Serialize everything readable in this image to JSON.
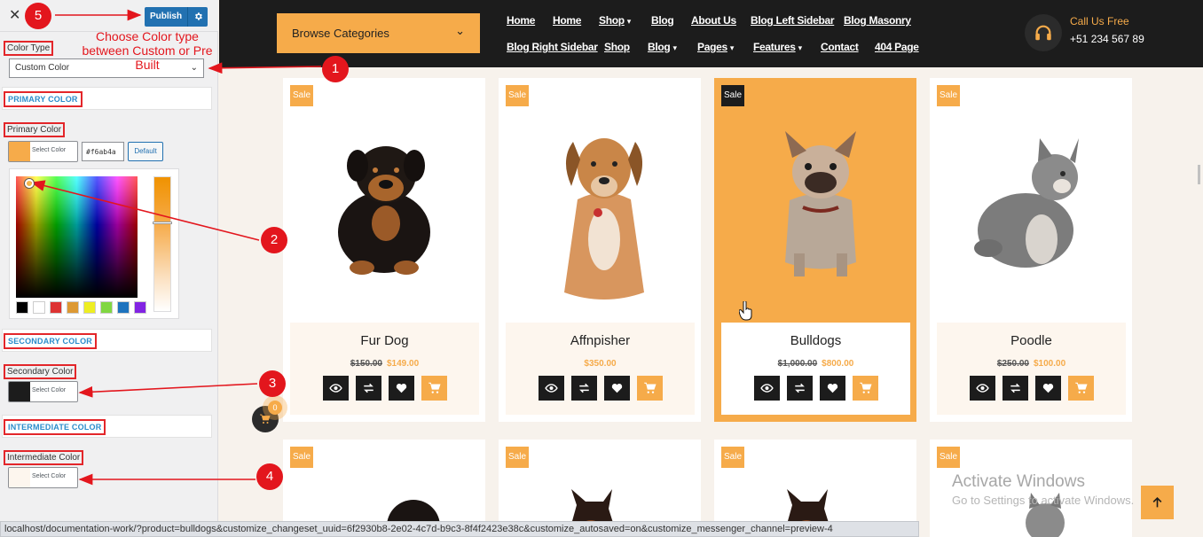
{
  "panel": {
    "publish_label": "Publish",
    "color_type_label": "Color Type",
    "color_type_value": "Custom Color",
    "primary_section": "PRIMARY COLOR",
    "primary_label": "Primary Color",
    "primary_hex": "#f6ab4a",
    "select_color_label": "Select Color",
    "default_label": "Default",
    "secondary_section": "SECONDARY COLOR",
    "secondary_label": "Secondary Color",
    "secondary_color": "#1c1c1c",
    "intermediate_section": "INTERMEDIATE COLOR",
    "intermediate_label": "Intermediate Color",
    "intermediate_color": "#fdf6ee",
    "palette": [
      "#000000",
      "#ffffff",
      "#dd3333",
      "#dd9933",
      "#eeee22",
      "#81d742",
      "#1e73be",
      "#8224e3"
    ]
  },
  "annotations": {
    "n1": "1",
    "n2": "2",
    "n3": "3",
    "n4": "4",
    "n5": "5",
    "note": "Choose Color type between Custom or Pre Built"
  },
  "header": {
    "browse_label": "Browse Categories",
    "nav_row1": [
      "Home",
      "Home",
      "Shop",
      "Blog",
      "About Us",
      "Blog Left Sidebar",
      "Blog Masonry"
    ],
    "nav_row2": [
      "Blog Right Sidebar",
      "Shop",
      "Blog",
      "Pages",
      "Features",
      "Contact",
      "404 Page"
    ],
    "call_label": "Call Us Free",
    "call_number": "+51 234 567 89"
  },
  "products": [
    {
      "sale": "Sale",
      "name": "Fur Dog",
      "old_price": "$150.00",
      "new_price": "$149.00"
    },
    {
      "sale": "Sale",
      "name": "Affnpisher",
      "old_price": "",
      "new_price": "$350.00"
    },
    {
      "sale": "Sale",
      "name": "Bulldogs",
      "old_price": "$1,000.00",
      "new_price": "$800.00"
    },
    {
      "sale": "Sale",
      "name": "Poodle",
      "old_price": "$250.00",
      "new_price": "$100.00"
    }
  ],
  "row2_sale": [
    "Sale",
    "Sale",
    "Sale",
    "Sale"
  ],
  "cart_count": "0",
  "watermark": {
    "title": "Activate Windows",
    "subtitle": "Go to Settings to activate Windows."
  },
  "status_url": "localhost/documentation-work/?product=bulldogs&customize_changeset_uuid=6f2930b8-2e02-4c7d-b9c3-8f4f2423e38c&customize_autosaved=on&customize_messenger_channel=preview-4",
  "colors": {
    "accent": "#f6ab4a",
    "dark": "#1c1c1c",
    "annotation": "#e3161d",
    "link": "#2a8ccb"
  }
}
